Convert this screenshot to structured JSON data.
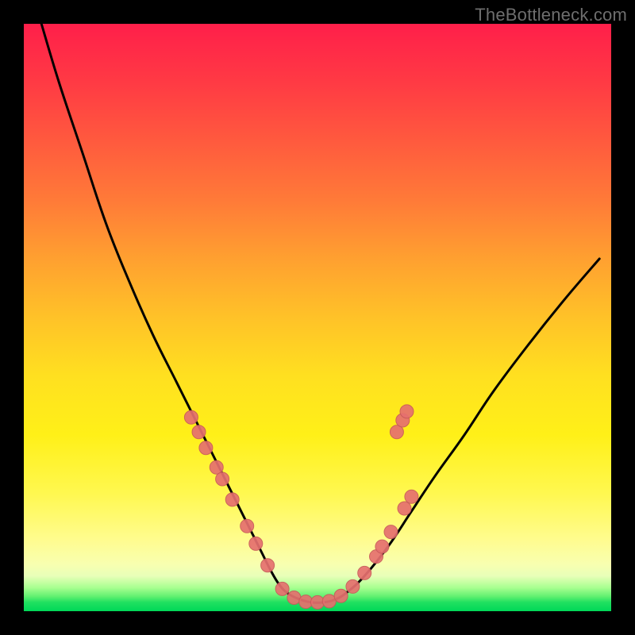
{
  "watermark": "TheBottleneck.com",
  "colors": {
    "frame": "#000000",
    "curve_stroke": "#000000",
    "marker_fill": "#e6706f",
    "marker_stroke": "#c85a5a"
  },
  "chart_data": {
    "type": "line",
    "title": "",
    "xlabel": "",
    "ylabel": "",
    "xlim": [
      0,
      100
    ],
    "ylim": [
      0,
      100
    ],
    "grid": false,
    "legend": false,
    "series": [
      {
        "name": "bottleneck-curve",
        "x": [
          3,
          6,
          10,
          14,
          18,
          22,
          26,
          30,
          33,
          36,
          38.5,
          40.5,
          42,
          43.5,
          45,
          47,
          49,
          51,
          53,
          55,
          58,
          62,
          66,
          70,
          75,
          80,
          86,
          92,
          98
        ],
        "y": [
          100,
          90,
          78,
          66,
          56,
          47,
          39,
          31,
          25,
          19,
          14,
          10,
          7,
          4.5,
          3,
          2,
          1.5,
          1.5,
          2,
          3.2,
          6,
          11,
          17,
          23,
          30,
          37.5,
          45.5,
          53,
          60
        ]
      }
    ],
    "markers": [
      {
        "x": 28.5,
        "y": 33.0
      },
      {
        "x": 29.8,
        "y": 30.5
      },
      {
        "x": 31.0,
        "y": 27.8
      },
      {
        "x": 32.8,
        "y": 24.5
      },
      {
        "x": 33.8,
        "y": 22.5
      },
      {
        "x": 35.5,
        "y": 19.0
      },
      {
        "x": 38.0,
        "y": 14.5
      },
      {
        "x": 39.5,
        "y": 11.5
      },
      {
        "x": 41.5,
        "y": 7.8
      },
      {
        "x": 44.0,
        "y": 3.8
      },
      {
        "x": 46.0,
        "y": 2.3
      },
      {
        "x": 48.0,
        "y": 1.6
      },
      {
        "x": 50.0,
        "y": 1.5
      },
      {
        "x": 52.0,
        "y": 1.7
      },
      {
        "x": 54.0,
        "y": 2.6
      },
      {
        "x": 56.0,
        "y": 4.2
      },
      {
        "x": 58.0,
        "y": 6.5
      },
      {
        "x": 60.0,
        "y": 9.3
      },
      {
        "x": 61.0,
        "y": 11.0
      },
      {
        "x": 62.5,
        "y": 13.5
      },
      {
        "x": 64.8,
        "y": 17.5
      },
      {
        "x": 66.0,
        "y": 19.5
      },
      {
        "x": 63.5,
        "y": 30.5
      },
      {
        "x": 64.5,
        "y": 32.5
      },
      {
        "x": 65.2,
        "y": 34.0
      }
    ]
  }
}
